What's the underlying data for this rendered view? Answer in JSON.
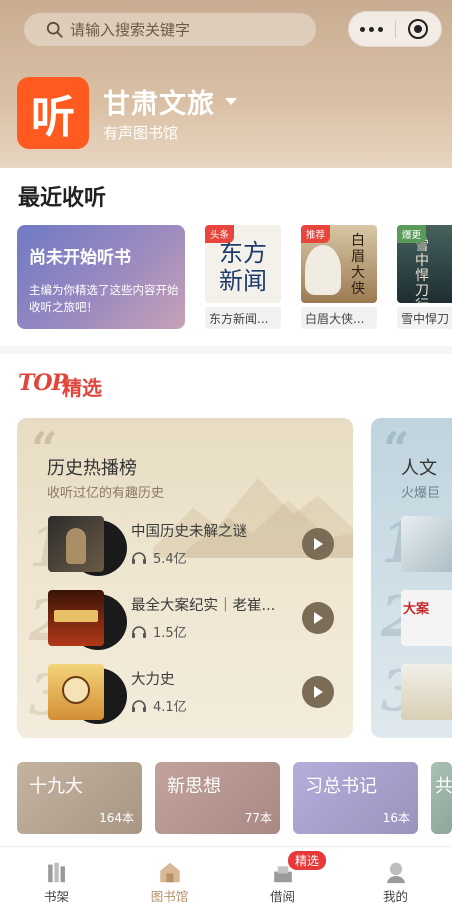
{
  "search": {
    "placeholder": "请输入搜索关键字"
  },
  "brand": {
    "logo_char": "听",
    "title": "甘肃文旅",
    "subtitle": "有声图书馆"
  },
  "recent": {
    "title": "最近收听",
    "promo_title": "尚未开始听书",
    "promo_text": "主编为你精选了这些内容开始收听之旅吧！",
    "books": [
      {
        "tag": "头条",
        "tag_color": "#e8453c",
        "cover_text": "东方新闻",
        "name": "东方新闻..."
      },
      {
        "tag": "推荐",
        "tag_color": "#e8453c",
        "cover_text": "白眉大侠",
        "name": "白眉大侠..."
      },
      {
        "tag": "爆更",
        "tag_color": "#5a9a5a",
        "cover_text": "雪中悍刀行",
        "name": "雪中悍刀"
      }
    ]
  },
  "top": {
    "logo": "TOP",
    "label": "精选"
  },
  "ranking": {
    "quote": "“",
    "title": "历史热播榜",
    "subtitle": "收听过亿的有趣历史",
    "items": [
      {
        "rank": "1",
        "name": "中国历史未解之谜",
        "plays": "5.4亿"
      },
      {
        "rank": "2",
        "name": "最全大案纪实｜老崔...",
        "plays": "1.5亿"
      },
      {
        "rank": "3",
        "name": "大力史",
        "plays": "4.1亿"
      }
    ]
  },
  "ranking2": {
    "title": "人文",
    "subtitle": "火爆巨",
    "ranks": [
      "1",
      "2",
      "3"
    ],
    "item_label": "大案"
  },
  "categories": [
    {
      "label": "十九大",
      "count": "164本",
      "color": "#b9a894"
    },
    {
      "label": "新思想",
      "count": "77本",
      "color": "#b79a96"
    },
    {
      "label": "习总书记",
      "count": "16本",
      "color": "#aca5c6"
    },
    {
      "label": "共",
      "count": "",
      "color": "#9fb5a8"
    }
  ],
  "tabs": [
    {
      "label": "书架"
    },
    {
      "label": "图书馆"
    },
    {
      "label": "借阅",
      "badge": "精选"
    },
    {
      "label": "我的"
    }
  ]
}
